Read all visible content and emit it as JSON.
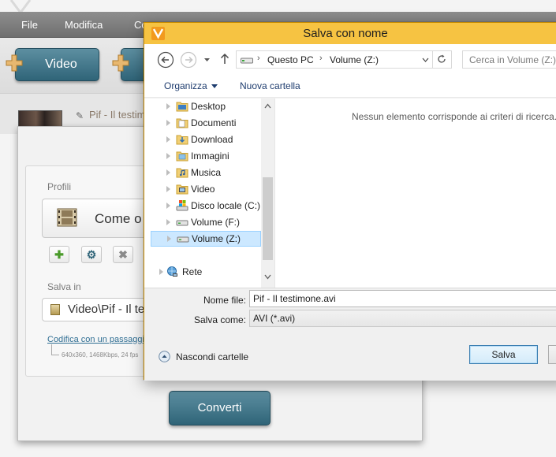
{
  "app": {
    "menu": [
      "File",
      "Modifica",
      "Co"
    ],
    "toolbar": {
      "video_button": "Video"
    },
    "file_title": "Pif - Il testim",
    "panel": {
      "profiles_label": "Profili",
      "profile_value": "Come o",
      "save_in_label": "Salva in",
      "save_in_value": "Video\\Pif - Il te",
      "encode_link": "Codifica con un passaggio",
      "specs": "640x360, 1468Kbps, 24 fps",
      "convert_button": "Converti"
    }
  },
  "dialog": {
    "title": "Salva con nome",
    "breadcrumb": [
      "Questo PC",
      "Volume (Z:)"
    ],
    "search_placeholder": "Cerca in Volume (Z:)",
    "commands": {
      "organize": "Organizza",
      "new_folder": "Nuova cartella"
    },
    "tree": [
      {
        "label": "Desktop",
        "icon": "desktop-folder-icon"
      },
      {
        "label": "Documenti",
        "icon": "documents-folder-icon"
      },
      {
        "label": "Download",
        "icon": "download-folder-icon"
      },
      {
        "label": "Immagini",
        "icon": "pictures-folder-icon"
      },
      {
        "label": "Musica",
        "icon": "music-folder-icon"
      },
      {
        "label": "Video",
        "icon": "video-folder-icon"
      },
      {
        "label": "Disco locale (C:)",
        "icon": "local-disk-icon"
      },
      {
        "label": "Volume (F:)",
        "icon": "drive-icon"
      },
      {
        "label": "Volume (Z:)",
        "icon": "drive-icon",
        "selected": true
      },
      {
        "label": "Rete",
        "icon": "network-icon"
      }
    ],
    "empty_message": "Nessun elemento corrisponde ai criteri di ricerca.",
    "filename_label": "Nome file:",
    "filename_value": "Pif - Il testimone.avi",
    "savetype_label": "Salva come:",
    "savetype_value": "AVI (*.avi)",
    "hide_folders": "Nascondi cartelle",
    "save_button": "Salva"
  },
  "colors": {
    "titlebar": "#f6c342",
    "accent_button": "#2f6478",
    "selection": "#cce8ff",
    "link": "#1e3c6e"
  }
}
